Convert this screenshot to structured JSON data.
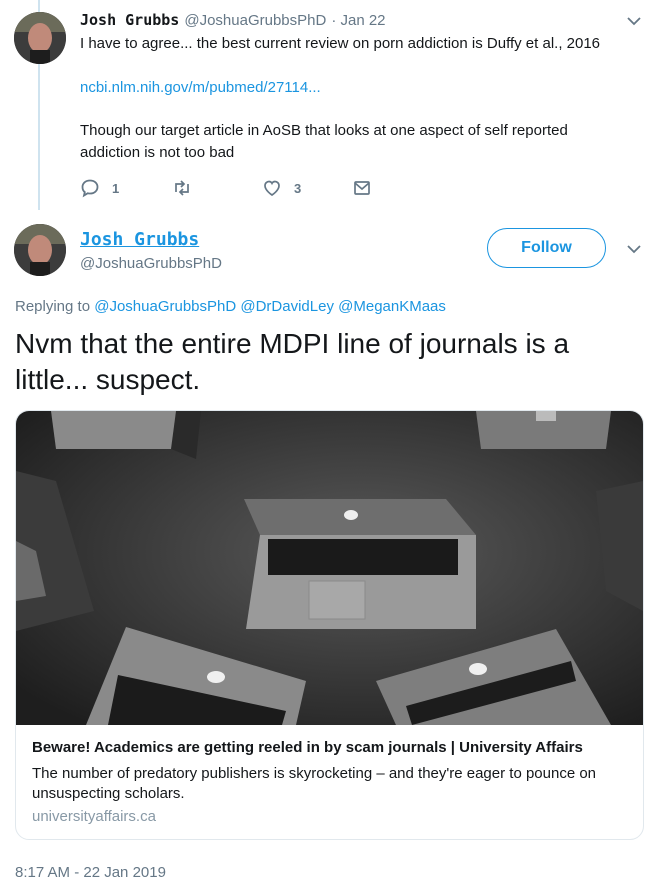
{
  "reply_tweet": {
    "name": "Josh Grubbs",
    "handle": "@JoshuaGrubbsPhD",
    "date": "· Jan 22",
    "text_line1": "I have to agree...  the best current review on porn addiction is Duffy et al., 2016",
    "link": "ncbi.nlm.nih.gov/m/pubmed/27114...",
    "text_line2": "Though our target article in AoSB that looks at one aspect of self reported",
    "text_line3": "addiction is not too bad",
    "reply_count": "1",
    "like_count": "3"
  },
  "main_tweet": {
    "name": "Josh Grubbs",
    "handle": "@JoshuaGrubbsPhD",
    "follow_label": "Follow",
    "replying_prefix": "Replying to",
    "replying_to": [
      "@JoshuaGrubbsPhD",
      "@DrDavidLey",
      "@MeganKMaas"
    ],
    "text_line1": "Nvm that the entire MDPI line of journals is a",
    "text_line2": "little... suspect.",
    "timestamp": "8:17 AM - 22 Jan 2019"
  },
  "card": {
    "title": "Beware! Academics are getting reeled in by scam journals | University Affairs",
    "desc_line1": "The number of predatory publishers is skyrocketing – and they're eager to pounce on",
    "desc_line2": "unsuspecting scholars.",
    "domain": "universityaffairs.ca"
  },
  "icons": [
    "reply-icon",
    "retweet-icon",
    "heart-icon",
    "message-icon",
    "chevron-down-icon"
  ],
  "colors": {
    "link": "#1b95e0",
    "muted": "#657786",
    "thread": "#cfe3ef"
  }
}
